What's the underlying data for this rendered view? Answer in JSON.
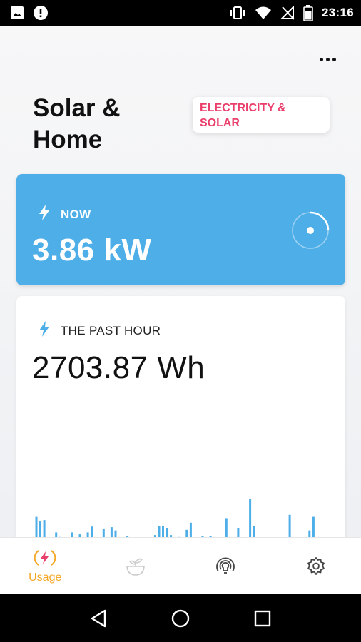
{
  "status_bar": {
    "time": "23:16",
    "left_icons": [
      "image-icon",
      "alert-icon"
    ],
    "right_icons": [
      "vibrate-icon",
      "wifi-icon",
      "no-signal-icon",
      "battery-icon"
    ]
  },
  "header": {
    "title": "Solar & Home",
    "badge": "ELECTRICITY & SOLAR",
    "menu_icon": "more-horizontal-icon"
  },
  "now_card": {
    "label": "NOW",
    "value": "3.86 kW",
    "icon": "bolt-icon",
    "color": "#4daee8"
  },
  "hour_card": {
    "label": "THE PAST HOUR",
    "value": "2703.87 Wh",
    "icon": "bolt-icon",
    "bar_color": "#4daee8"
  },
  "chart_data": {
    "type": "bar",
    "title": "",
    "xlabel": "",
    "ylabel": "",
    "ylim": [
      0,
      100
    ],
    "values": [
      73,
      66,
      68,
      0,
      0,
      49,
      42,
      0,
      23,
      49,
      36,
      46,
      0,
      49,
      58,
      0,
      21,
      55,
      0,
      57,
      52,
      32,
      21,
      44,
      0,
      29,
      34,
      35,
      35,
      0,
      45,
      59,
      59,
      56,
      45,
      33,
      42,
      33,
      53,
      64,
      0,
      8,
      43,
      17,
      44,
      28,
      0,
      10,
      71,
      24,
      39,
      56,
      32,
      20,
      100,
      59,
      34,
      19,
      0,
      31,
      22,
      34,
      36,
      32,
      76,
      29,
      13,
      26,
      25,
      52,
      73,
      34,
      14,
      14
    ],
    "series": [
      {
        "name": "",
        "color": "#4daee8"
      }
    ]
  },
  "bottom_nav": {
    "items": [
      {
        "label": "Usage",
        "icon": "bolt-circle-icon",
        "active": true
      },
      {
        "label": "",
        "icon": "plant-icon",
        "active": false
      },
      {
        "label": "",
        "icon": "bulb-radiating-icon",
        "active": false
      },
      {
        "label": "",
        "icon": "gear-icon",
        "active": false
      }
    ],
    "active_color": "#f5a623",
    "inactive_color": "#555555"
  },
  "system_nav": [
    "back-icon",
    "home-icon",
    "recents-icon"
  ]
}
